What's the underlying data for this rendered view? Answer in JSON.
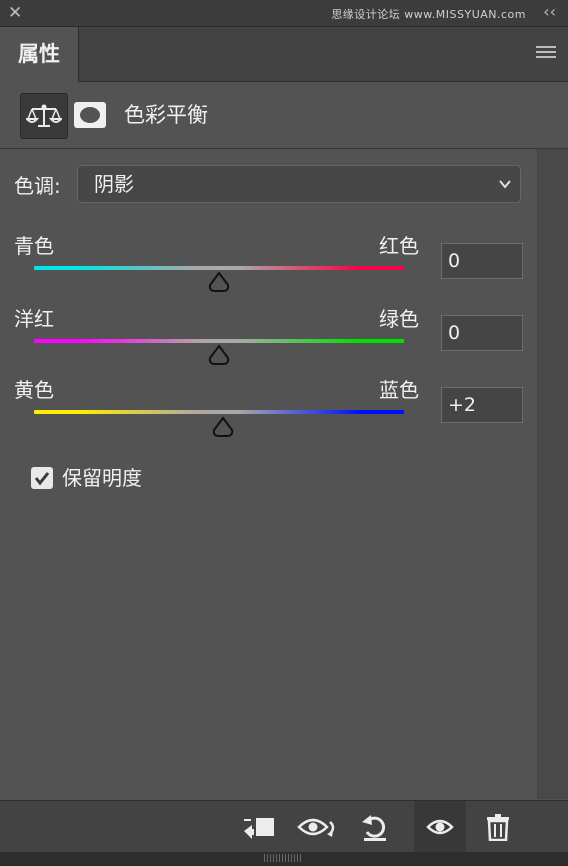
{
  "titlebar": {
    "close_icon": "close-icon",
    "watermark": "思缘设计论坛 www.MISSYUAN.com",
    "collapse_icon": "double-chevron-icon"
  },
  "tabs": [
    {
      "label": "属性",
      "active": true
    }
  ],
  "panel_menu_icon": "hamburger-menu-icon",
  "adjustment": {
    "icon": "balance-scale-icon",
    "mask_icon": "layer-mask-icon",
    "title": "色彩平衡"
  },
  "tone": {
    "label": "色调:",
    "selected": "阴影"
  },
  "sliders": [
    {
      "left_label": "青色",
      "right_label": "红色",
      "value": "0",
      "numeric": 0,
      "gradient": [
        "#00e5e5",
        "#ff0040"
      ]
    },
    {
      "left_label": "洋红",
      "right_label": "绿色",
      "value": "0",
      "numeric": 0,
      "gradient": [
        "#ff00ff",
        "#00e000"
      ]
    },
    {
      "left_label": "黄色",
      "right_label": "蓝色",
      "value": "+2",
      "numeric": 2,
      "gradient": [
        "#ffee00",
        "#0010ff"
      ]
    }
  ],
  "preserve_luminosity": {
    "label": "保留明度",
    "checked": true
  },
  "footer": {
    "icons": [
      "clip-to-layer-icon",
      "view-previous-icon",
      "reset-icon",
      "visibility-eye-icon",
      "trash-icon"
    ]
  },
  "colors": {
    "panel_bg": "#535353",
    "text": "#f0f0f0"
  }
}
